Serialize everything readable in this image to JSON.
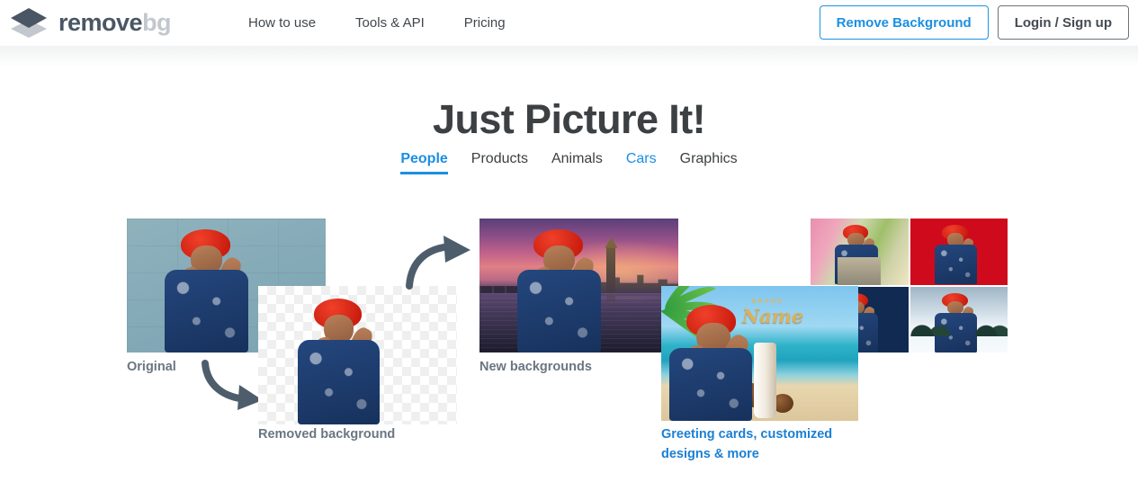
{
  "header": {
    "logo": {
      "name_dark": "remove",
      "name_light": "bg",
      "icon": "stacked-layers-icon"
    },
    "nav": [
      {
        "label": "How to use"
      },
      {
        "label": "Tools & API"
      },
      {
        "label": "Pricing"
      }
    ],
    "buttons": {
      "primary": "Remove Background",
      "secondary": "Login / Sign up"
    }
  },
  "hero": {
    "title": "Just Picture It!",
    "tabs": [
      {
        "label": "People",
        "state": "active"
      },
      {
        "label": "Products",
        "state": "default"
      },
      {
        "label": "Animals",
        "state": "default"
      },
      {
        "label": "Cars",
        "state": "highlight"
      },
      {
        "label": "Graphics",
        "state": "default"
      }
    ]
  },
  "showcase": {
    "original": {
      "caption": "Original",
      "description": "Woman with red afro hair in a blue floral dress against a teal cinder-block wall"
    },
    "removed": {
      "caption": "Removed background",
      "description": "Same subject cut out on a transparent checkerboard"
    },
    "new_backgrounds": {
      "caption": "New backgrounds",
      "description": "Subject composited over a London sunset with Big Ben"
    },
    "cards": {
      "caption": "Greeting cards, customized designs & more",
      "brand_eyebrow": "BRAND",
      "brand_name": "Name",
      "description": "Tropical beach product advert with palm leaves, coconuts and a cosmetic tube"
    },
    "variants": [
      {
        "name": "village-street",
        "color": "#e88fb0"
      },
      {
        "name": "solid-red",
        "color": "#cf0a1c"
      },
      {
        "name": "solid-navy",
        "color": "#102a52"
      },
      {
        "name": "snowy-forest",
        "color": "#cfdce6"
      }
    ],
    "arrows": [
      {
        "name": "arrow-down-right"
      },
      {
        "name": "arrow-up-right"
      }
    ]
  },
  "colors": {
    "accent_blue": "#1a8fe3",
    "link_blue": "#1a7fd4",
    "text_dark": "#3c4043",
    "caption_gray": "#6a7682",
    "logo_dark": "#4a5663",
    "logo_light": "#c2c8ce",
    "arrow_gray": "#4e5d6c"
  }
}
